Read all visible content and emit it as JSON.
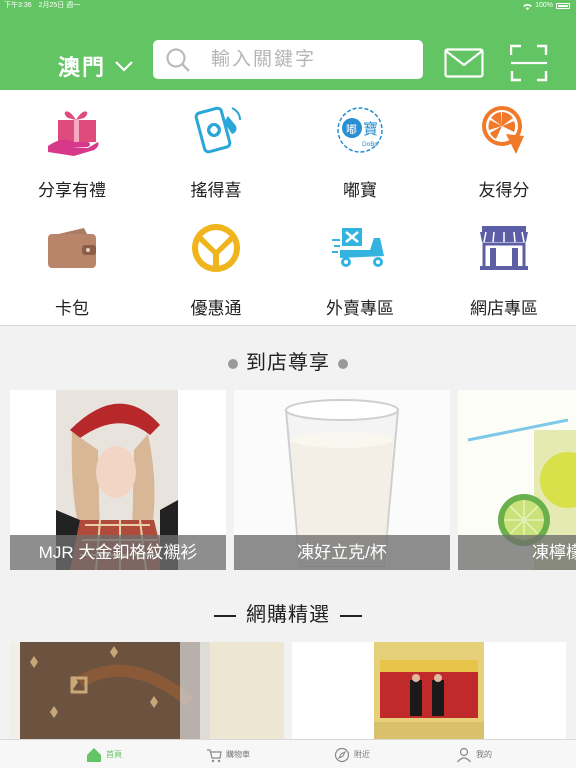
{
  "status_bar": {
    "time_date": "下午3:36　2月25日 週一",
    "battery": "100%"
  },
  "header": {
    "city": "澳門",
    "search_placeholder": "輸入關鍵字"
  },
  "quick_entries": [
    {
      "label": "分享有禮",
      "icon": "gift-icon"
    },
    {
      "label": "搖得喜",
      "icon": "shake-phone-icon"
    },
    {
      "label": "嘟寶",
      "icon": "dobo-logo-icon"
    },
    {
      "label": "友得分",
      "icon": "orange-slice-icon"
    },
    {
      "label": "卡包",
      "icon": "wallet-icon"
    },
    {
      "label": "優惠通",
      "icon": "yen-coin-icon"
    },
    {
      "label": "外賣專區",
      "icon": "delivery-scooter-icon"
    },
    {
      "label": "網店專區",
      "icon": "storefront-icon"
    }
  ],
  "in_store": {
    "title": "到店尊享",
    "items": [
      {
        "caption": "MJR 大金釦格紋襯衫"
      },
      {
        "caption": "凍好立克/杯"
      },
      {
        "caption": "凍檸檬雪"
      }
    ]
  },
  "online": {
    "title": "網購精選"
  },
  "tabbar": [
    {
      "label": "首頁",
      "icon": "home-icon",
      "active": true
    },
    {
      "label": "購物車",
      "icon": "cart-icon",
      "active": false
    },
    {
      "label": "附近",
      "icon": "compass-icon",
      "active": false
    },
    {
      "label": "我的",
      "icon": "profile-icon",
      "active": false
    }
  ],
  "colors": {
    "brand_green": "#62c462",
    "caption_bg": "#6e6e6e"
  }
}
